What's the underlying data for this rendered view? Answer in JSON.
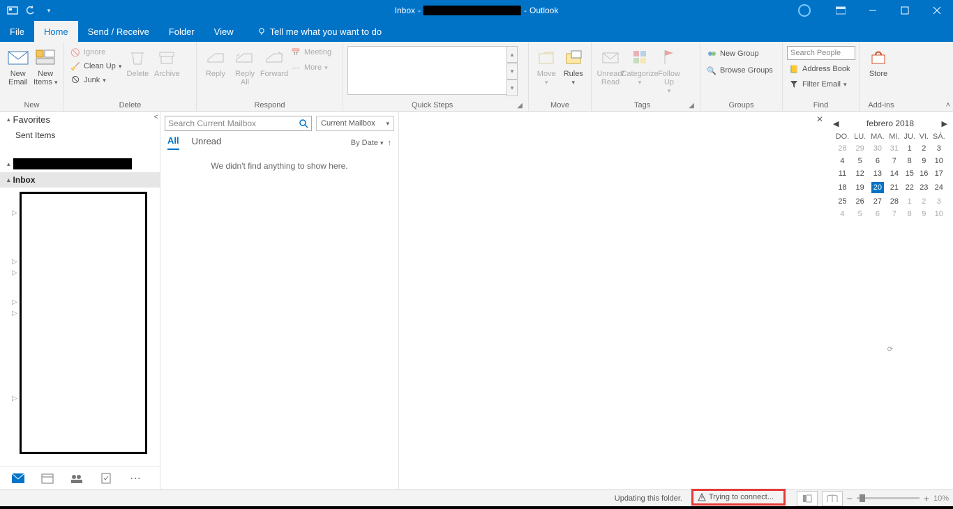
{
  "titlebar": {
    "folder": "Inbox",
    "sep": " - ",
    "app": "Outlook"
  },
  "tabs": {
    "file": "File",
    "home": "Home",
    "sendreceive": "Send / Receive",
    "folder": "Folder",
    "view": "View",
    "tellme": "Tell me what you want to do"
  },
  "ribbon": {
    "new": {
      "label": "New",
      "newEmail": "New Email",
      "newItems": "New Items"
    },
    "delete": {
      "label": "Delete",
      "ignore": "Ignore",
      "cleanup": "Clean Up",
      "junk": "Junk",
      "delete": "Delete",
      "archive": "Archive"
    },
    "respond": {
      "label": "Respond",
      "reply": "Reply",
      "replyAll": "Reply All",
      "forward": "Forward",
      "meeting": "Meeting",
      "more": "More"
    },
    "quicksteps": {
      "label": "Quick Steps"
    },
    "move": {
      "label": "Move",
      "move": "Move",
      "rules": "Rules"
    },
    "tags": {
      "label": "Tags",
      "unreadRead": "Unread/ Read",
      "categorize": "Categorize",
      "followUp": "Follow Up"
    },
    "groups": {
      "label": "Groups",
      "newGroup": "New Group",
      "browseGroups": "Browse Groups"
    },
    "find": {
      "label": "Find",
      "searchPeople": "Search People",
      "addressBook": "Address Book",
      "filterEmail": "Filter Email"
    },
    "addins": {
      "label": "Add-ins",
      "store": "Store"
    }
  },
  "leftnav": {
    "favorites": "Favorites",
    "sentItems": "Sent Items",
    "inbox": "Inbox"
  },
  "msglist": {
    "searchPlaceholder": "Search Current Mailbox",
    "scope": "Current Mailbox",
    "all": "All",
    "unread": "Unread",
    "sort": "By Date",
    "empty": "We didn't find anything to show here."
  },
  "calendar": {
    "title": "febrero 2018",
    "dow": [
      "DO.",
      "LU.",
      "MA.",
      "MI.",
      "JU.",
      "VI.",
      "SÁ."
    ],
    "weeks": [
      [
        {
          "d": "28",
          "off": true
        },
        {
          "d": "29",
          "off": true
        },
        {
          "d": "30",
          "off": true
        },
        {
          "d": "31",
          "off": true
        },
        {
          "d": "1"
        },
        {
          "d": "2"
        },
        {
          "d": "3"
        }
      ],
      [
        {
          "d": "4"
        },
        {
          "d": "5"
        },
        {
          "d": "6"
        },
        {
          "d": "7"
        },
        {
          "d": "8"
        },
        {
          "d": "9"
        },
        {
          "d": "10"
        }
      ],
      [
        {
          "d": "11"
        },
        {
          "d": "12"
        },
        {
          "d": "13"
        },
        {
          "d": "14"
        },
        {
          "d": "15"
        },
        {
          "d": "16"
        },
        {
          "d": "17"
        }
      ],
      [
        {
          "d": "18"
        },
        {
          "d": "19"
        },
        {
          "d": "20",
          "today": true
        },
        {
          "d": "21"
        },
        {
          "d": "22"
        },
        {
          "d": "23"
        },
        {
          "d": "24"
        }
      ],
      [
        {
          "d": "25"
        },
        {
          "d": "26"
        },
        {
          "d": "27"
        },
        {
          "d": "28"
        },
        {
          "d": "1",
          "off": true
        },
        {
          "d": "2",
          "off": true
        },
        {
          "d": "3",
          "off": true
        }
      ],
      [
        {
          "d": "4",
          "off": true
        },
        {
          "d": "5",
          "off": true
        },
        {
          "d": "6",
          "off": true
        },
        {
          "d": "7",
          "off": true
        },
        {
          "d": "8",
          "off": true
        },
        {
          "d": "9",
          "off": true
        },
        {
          "d": "10",
          "off": true
        }
      ]
    ]
  },
  "status": {
    "updating": "Updating this folder.",
    "connect": "Trying to connect...",
    "zoom": "10%"
  }
}
